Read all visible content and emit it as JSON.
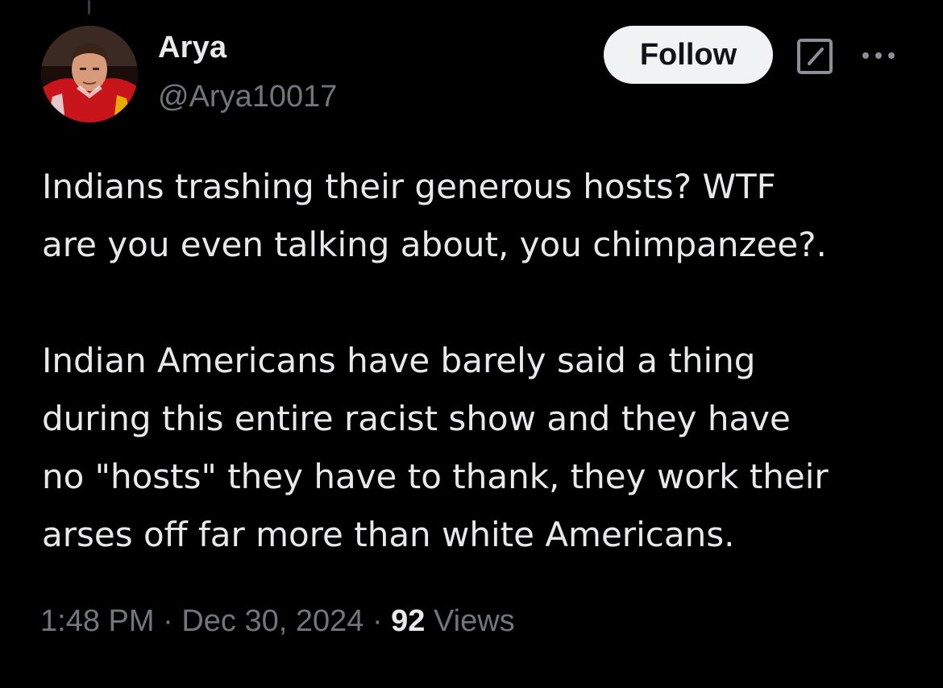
{
  "author": {
    "display_name": "Arya",
    "handle": "@Arya10017"
  },
  "actions": {
    "follow_label": "Follow",
    "grok_icon": "grok-icon",
    "more_icon": "more-options-icon"
  },
  "tweet": {
    "text": "Indians trashing their generous hosts? WTF\nare you even talking about, you chimpanzee?.\n\nIndian Americans have barely said a thing\nduring this entire racist show and they have\nno \"hosts\" they have to thank, they work their\narses off far more than white Americans."
  },
  "meta": {
    "time": "1:48 PM",
    "separator": "·",
    "date": "Dec 30, 2024",
    "views_count": "92",
    "views_label": "Views"
  },
  "colors": {
    "background": "#000000",
    "primary_text": "#e7e9ea",
    "secondary_text": "#71767b",
    "follow_bg": "#eff3f4",
    "follow_text": "#0f1419"
  }
}
